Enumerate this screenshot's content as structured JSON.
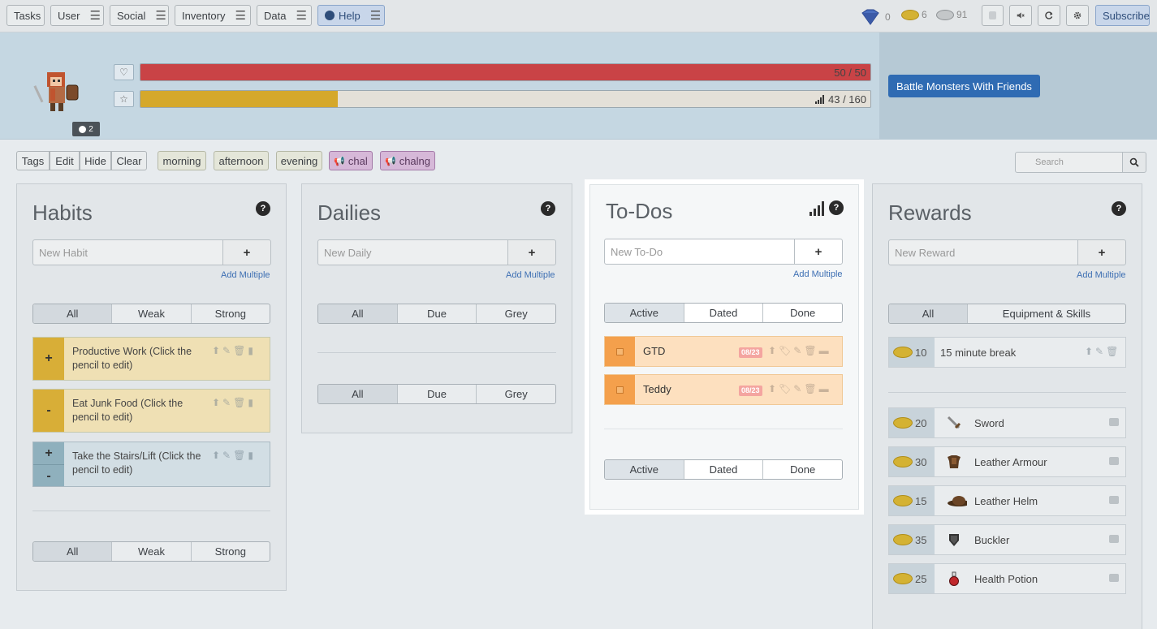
{
  "nav": {
    "items": [
      {
        "label": "Tasks",
        "menu": false
      },
      {
        "label": "User",
        "menu": true
      },
      {
        "label": "Social",
        "menu": true
      },
      {
        "label": "Inventory",
        "menu": true
      },
      {
        "label": "Data",
        "menu": true
      },
      {
        "label": "Help",
        "menu": true
      }
    ],
    "menu_glyph": "☰",
    "gems": "0",
    "gold": "6",
    "silver": "91",
    "subscribe": "Subscribe"
  },
  "header": {
    "party_badge": "2",
    "health": {
      "label": "50 / 50",
      "fraction": 1.0,
      "color": "#c94346"
    },
    "experience": {
      "label": "43 / 160",
      "fraction": 0.27,
      "color": "#d5a82b"
    },
    "cta": "Battle Monsters With Friends"
  },
  "tags": {
    "controls": [
      "Tags",
      "Edit",
      "Hide",
      "Clear"
    ],
    "items": [
      "morning",
      "afternoon",
      "evening"
    ],
    "challenges": [
      "chal",
      "chalng"
    ],
    "search_placeholder": "Search"
  },
  "habits": {
    "title": "Habits",
    "placeholder": "New Habit",
    "add_multiple": "Add Multiple",
    "filters": [
      "All",
      "Weak",
      "Strong"
    ],
    "items": [
      {
        "text": "Productive Work (Click the pencil to edit)",
        "up": "+",
        "down": ""
      },
      {
        "text": "Eat Junk Food (Click the pencil to edit)",
        "up": "",
        "down": "-"
      },
      {
        "text": "Take the Stairs/Lift (Click the pencil to edit)",
        "up": "+",
        "down": "-"
      }
    ]
  },
  "dailies": {
    "title": "Dailies",
    "placeholder": "New Daily",
    "add_multiple": "Add Multiple",
    "filters": [
      "All",
      "Due",
      "Grey"
    ]
  },
  "todos": {
    "title": "To-Dos",
    "placeholder": "New To-Do",
    "add_multiple": "Add Multiple",
    "filters": [
      "Active",
      "Dated",
      "Done"
    ],
    "items": [
      {
        "title": "GTD",
        "date": "08/23"
      },
      {
        "title": "Teddy",
        "date": "08/23"
      }
    ]
  },
  "rewards": {
    "title": "Rewards",
    "placeholder": "New Reward",
    "add_multiple": "Add Multiple",
    "filters": [
      "All",
      "Equipment & Skills"
    ],
    "custom": [
      {
        "cost": "10",
        "name": "15 minute break"
      }
    ],
    "equipment": [
      {
        "cost": "20",
        "name": "Sword",
        "icon": "sword-icon"
      },
      {
        "cost": "30",
        "name": "Leather Armour",
        "icon": "armour-icon"
      },
      {
        "cost": "15",
        "name": "Leather Helm",
        "icon": "helm-icon"
      },
      {
        "cost": "35",
        "name": "Buckler",
        "icon": "shield-icon"
      },
      {
        "cost": "25",
        "name": "Health Potion",
        "icon": "potion-icon"
      }
    ]
  }
}
